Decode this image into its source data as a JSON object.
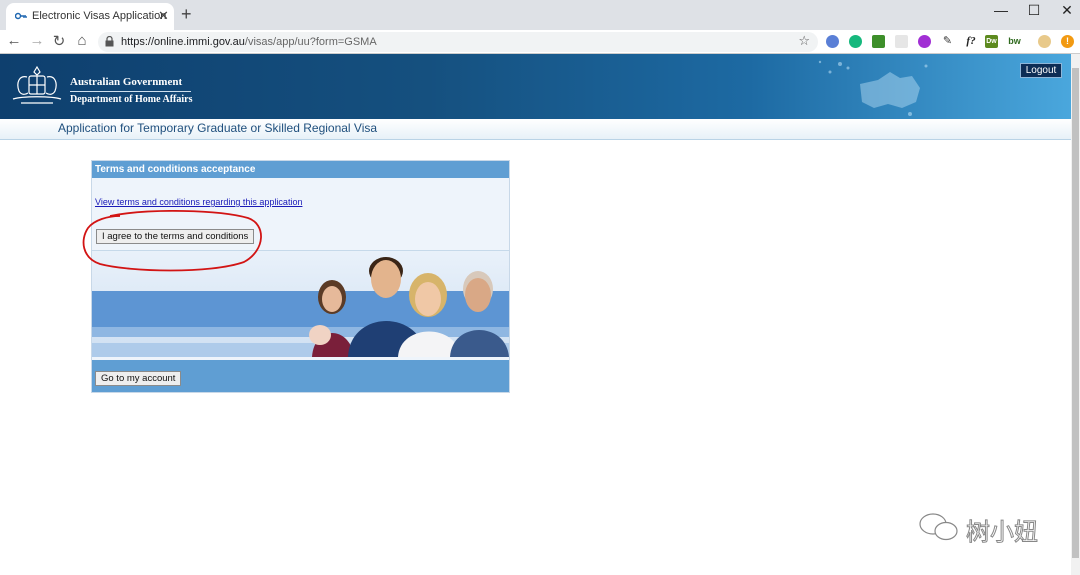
{
  "browser": {
    "tab_title": "Electronic Visas Application",
    "tab_close": "✕",
    "new_tab": "+",
    "window_controls": {
      "minimize": "—",
      "maximize": "☐",
      "close": "✕"
    },
    "nav": {
      "back": "←",
      "forward": "→",
      "reload": "↻",
      "home": "⌂"
    },
    "url_host": "https://online.immi.gov.au",
    "url_path": "/visas/app/uu?form=GSMA",
    "bookmark_star": "☆",
    "extensions": [
      "shield-extension-icon",
      "grammarly-extension-icon",
      "tree-extension-icon",
      "blank-extension-icon",
      "purple-extension-icon",
      "dropper-extension-icon",
      "font-extension-icon",
      "dw-extension-icon",
      "bw-extension-icon",
      "profile-avatar-icon",
      "alert-extension-icon"
    ],
    "extension_labels": {
      "font": "f?",
      "dw": "Dw",
      "bw": "bw",
      "alert": "!"
    }
  },
  "header": {
    "gov_line1": "Australian Government",
    "gov_line2": "Department of Home Affairs",
    "logout_label": "Logout",
    "subtitle": "Application for Temporary Graduate or Skilled Regional Visa"
  },
  "panel": {
    "heading": "Terms and conditions acceptance",
    "terms_link": "View terms and conditions regarding this application",
    "agree_label": "I agree to the terms and conditions",
    "account_label": "Go to my account"
  },
  "watermark": {
    "text": "树小妞"
  },
  "colors": {
    "banner_dark": "#0e3f6e",
    "banner_light": "#4aa7dd",
    "panel_head": "#5f9ed3",
    "annotation_red": "#d21414",
    "link": "#1a1ab8"
  }
}
